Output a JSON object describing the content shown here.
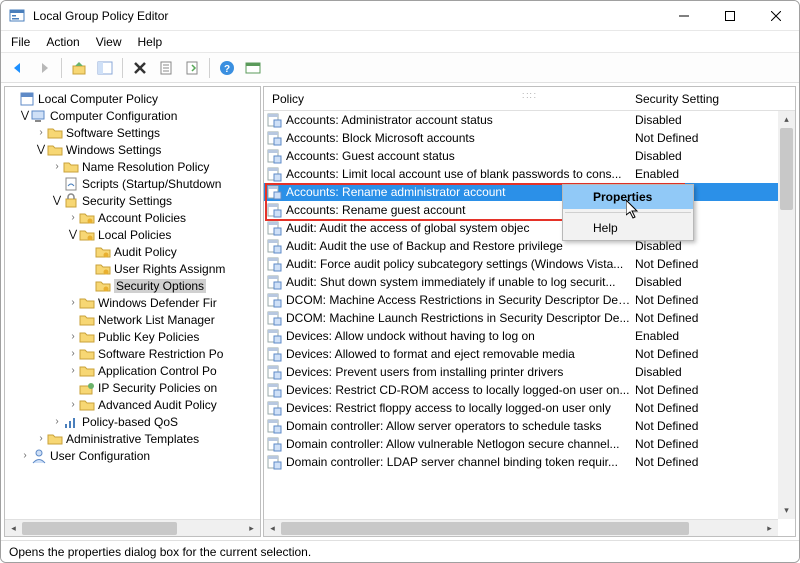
{
  "window": {
    "title": "Local Group Policy Editor"
  },
  "menu": {
    "file": "File",
    "action": "Action",
    "view": "View",
    "help": "Help"
  },
  "status": "Opens the properties dialog box for the current selection.",
  "columns": {
    "policy": "Policy",
    "setting": "Security Setting"
  },
  "contextmenu": {
    "properties": "Properties",
    "help": "Help"
  },
  "tree": {
    "root": "Local Computer Policy",
    "computer_config": "Computer Configuration",
    "software_settings": "Software Settings",
    "windows_settings": "Windows Settings",
    "name_resolution": "Name Resolution Policy",
    "scripts": "Scripts (Startup/Shutdown",
    "security_settings": "Security Settings",
    "account_policies": "Account Policies",
    "local_policies": "Local Policies",
    "audit_policy": "Audit Policy",
    "user_rights": "User Rights Assignm",
    "security_options": "Security Options",
    "win_defender": "Windows Defender Fir",
    "netlist": "Network List Manager",
    "pubkey": "Public Key Policies",
    "swrestrict": "Software Restriction Po",
    "appctrl": "Application Control Po",
    "ipsec": "IP Security Policies on",
    "advaudit": "Advanced Audit Policy",
    "qos": "Policy-based QoS",
    "admintemp": "Administrative Templates",
    "user_config": "User Configuration"
  },
  "rows": [
    {
      "name": "Accounts: Administrator account status",
      "value": "Disabled"
    },
    {
      "name": "Accounts: Block Microsoft accounts",
      "value": "Not Defined"
    },
    {
      "name": "Accounts: Guest account status",
      "value": "Disabled"
    },
    {
      "name": "Accounts: Limit local account use of blank passwords to cons...",
      "value": "Enabled"
    },
    {
      "name": "Accounts: Rename administrator account",
      "value": "ator"
    },
    {
      "name": "Accounts: Rename guest account",
      "value": ""
    },
    {
      "name": "Audit: Audit the access of global system objec",
      "value": ""
    },
    {
      "name": "Audit: Audit the use of Backup and Restore privilege",
      "value": "Disabled"
    },
    {
      "name": "Audit: Force audit policy subcategory settings (Windows Vista...",
      "value": "Not Defined"
    },
    {
      "name": "Audit: Shut down system immediately if unable to log securit...",
      "value": "Disabled"
    },
    {
      "name": "DCOM: Machine Access Restrictions in Security Descriptor Def...",
      "value": "Not Defined"
    },
    {
      "name": "DCOM: Machine Launch Restrictions in Security Descriptor De...",
      "value": "Not Defined"
    },
    {
      "name": "Devices: Allow undock without having to log on",
      "value": "Enabled"
    },
    {
      "name": "Devices: Allowed to format and eject removable media",
      "value": "Not Defined"
    },
    {
      "name": "Devices: Prevent users from installing printer drivers",
      "value": "Disabled"
    },
    {
      "name": "Devices: Restrict CD-ROM access to locally logged-on user on...",
      "value": "Not Defined"
    },
    {
      "name": "Devices: Restrict floppy access to locally logged-on user only",
      "value": "Not Defined"
    },
    {
      "name": "Domain controller: Allow server operators to schedule tasks",
      "value": "Not Defined"
    },
    {
      "name": "Domain controller: Allow vulnerable Netlogon secure channel...",
      "value": "Not Defined"
    },
    {
      "name": "Domain controller: LDAP server channel binding token requir...",
      "value": "Not Defined"
    }
  ]
}
